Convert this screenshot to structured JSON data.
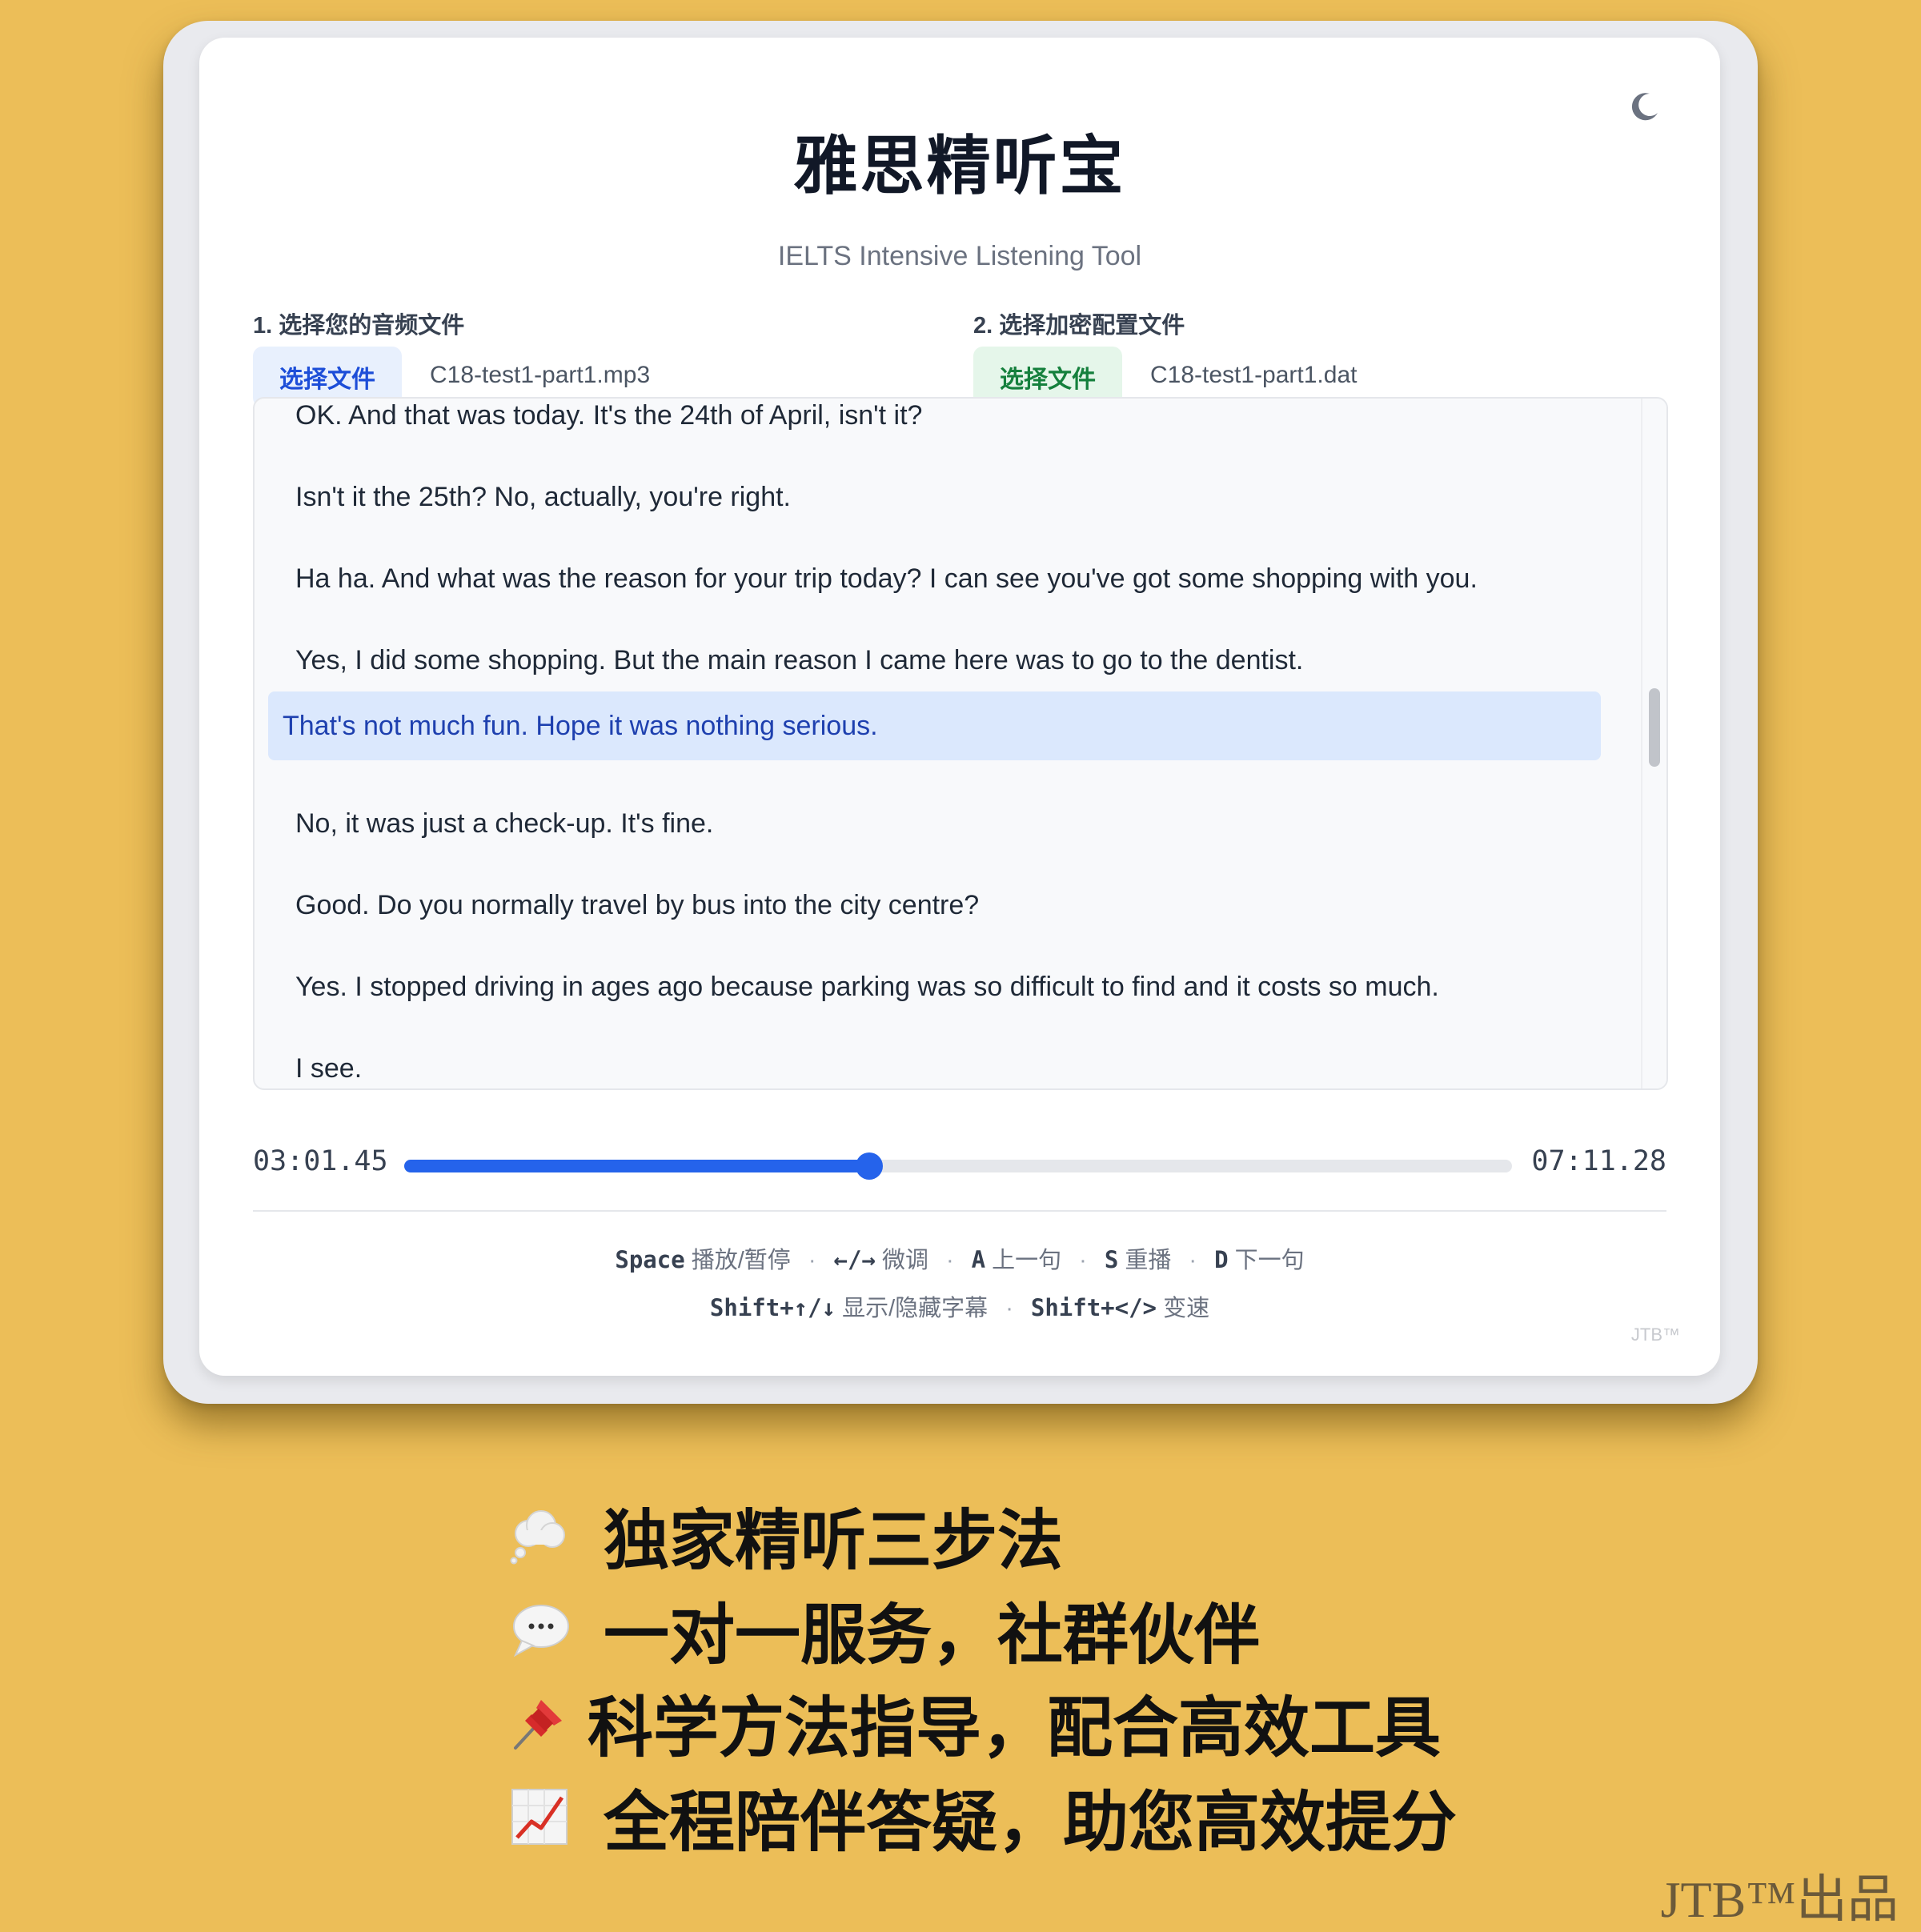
{
  "app": {
    "title": "雅思精听宝",
    "subtitle": "IELTS Intensive Listening Tool",
    "theme_toggle_icon": "moon-icon"
  },
  "audio_picker": {
    "label": "1. 选择您的音频文件",
    "button": "选择文件",
    "file_name": "C18-test1-part1.mp3"
  },
  "config_picker": {
    "label": "2. 选择加密配置文件",
    "button": "选择文件",
    "file_name": "C18-test1-part1.dat"
  },
  "transcript": {
    "lines": [
      "OK. And that was today. It's the 24th of April, isn't it?",
      "Isn't it the 25th? No, actually, you're right.",
      "Ha ha. And what was the reason for your trip today? I can see you've got some shopping with you.",
      "Yes, I did some shopping. But the main reason I came here was to go to the dentist.",
      "That's not much fun. Hope it was nothing serious.",
      "No, it was just a check-up. It's fine.",
      "Good. Do you normally travel by bus into the city centre?",
      "Yes. I stopped driving in ages ago because parking was so difficult to find and it costs so much.",
      "I see."
    ],
    "active_index": 4,
    "colors": {
      "active_bg": "#dbe8fd",
      "active_text": "#1e40af"
    }
  },
  "player": {
    "current_time": "03:01.45",
    "total_time": "07:11.28",
    "progress": 0.42,
    "accent": "#2563eb"
  },
  "shortcuts": {
    "row1": [
      {
        "key": "Space",
        "desc": "播放/暂停"
      },
      {
        "key": "←/→",
        "desc": "微调"
      },
      {
        "key": "A",
        "desc": "上一句"
      },
      {
        "key": "S",
        "desc": "重播"
      },
      {
        "key": "D",
        "desc": "下一句"
      }
    ],
    "row2": [
      {
        "key": "Shift+↑/↓",
        "desc": "显示/隐藏字幕"
      },
      {
        "key": "Shift+</>",
        "desc": "变速"
      }
    ],
    "separator": "·"
  },
  "card_brand": "JTB™",
  "features": [
    {
      "icon": "thought-balloon-icon",
      "text": "独家精听三步法"
    },
    {
      "icon": "speech-balloon-icon",
      "text": "一对一服务，社群伙伴"
    },
    {
      "icon": "pushpin-icon",
      "text": "科学方法指导，配合高效工具"
    },
    {
      "icon": "chart-increasing-icon",
      "text": "全程陪伴答疑，助您高效提分"
    }
  ],
  "footer_brand": "JTB™出品",
  "background_color": "#ECBE58"
}
